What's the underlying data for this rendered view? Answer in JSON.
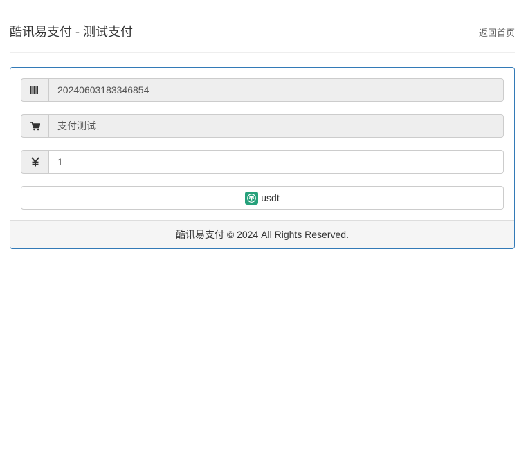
{
  "header": {
    "title": "酷讯易支付 - 测试支付",
    "home_link": "返回首页"
  },
  "form": {
    "order_no": {
      "icon": "barcode-icon",
      "value": "20240603183346854"
    },
    "product": {
      "icon": "cart-icon",
      "value": "支付测试"
    },
    "amount": {
      "icon": "yen-icon",
      "value": "1"
    },
    "pay_button": {
      "icon": "tether-usdt-icon",
      "label": "usdt",
      "icon_color": "#26a17b"
    }
  },
  "footer": {
    "text": "酷讯易支付 © 2024 All Rights Reserved."
  },
  "colors": {
    "panel_border": "#337ab7",
    "addon_bg": "#eeeeee",
    "footer_bg": "#f5f5f5"
  }
}
